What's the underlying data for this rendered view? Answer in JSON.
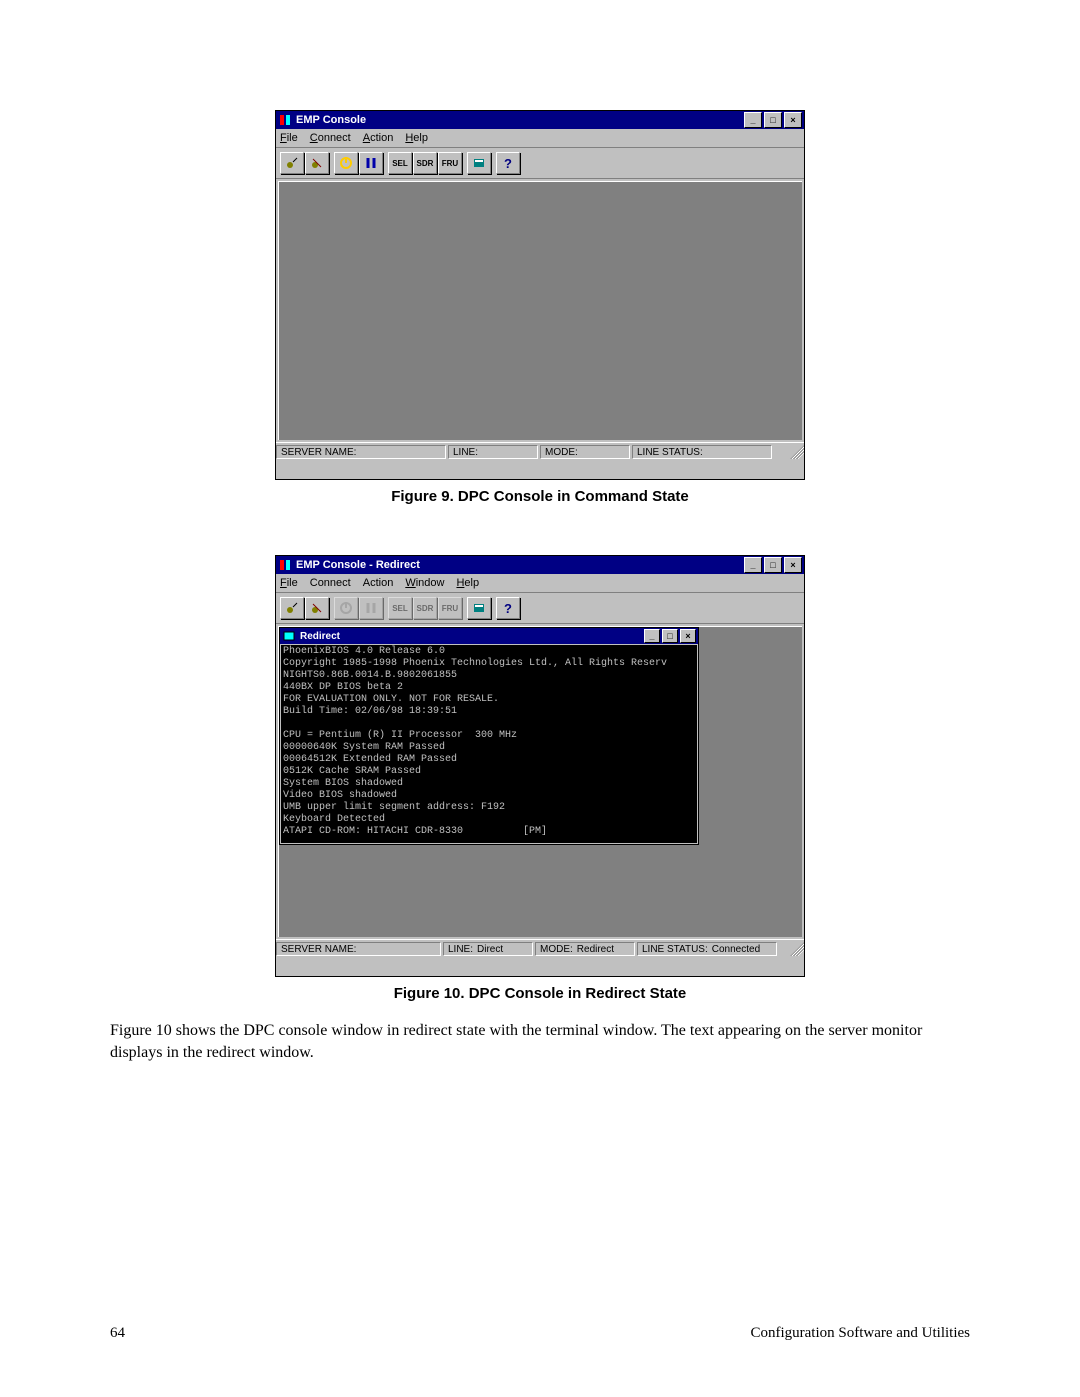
{
  "page": {
    "number": "64",
    "footer_right": "Configuration Software and Utilities"
  },
  "fig1": {
    "title": "EMP Console",
    "menu": {
      "file": "File",
      "connect": "Connect",
      "action": "Action",
      "help": "Help"
    },
    "toolbar": {
      "connect": "connect-icon",
      "disconnect": "disconnect-icon",
      "power": "power-icon",
      "reset": "reset-icon",
      "sel": "SEL",
      "sdr": "SDR",
      "fru": "FRU",
      "phone": "phonebook-icon",
      "help": "?"
    },
    "status": {
      "server_label": "SERVER NAME:",
      "server_value": "",
      "line_label": "LINE:",
      "line_value": "",
      "mode_label": "MODE:",
      "mode_value": "",
      "linestat_label": "LINE STATUS:",
      "linestat_value": ""
    },
    "caption": "Figure 9.  DPC Console in Command State"
  },
  "fig2": {
    "title": "EMP Console - Redirect",
    "menu": {
      "file": "File",
      "connect": "Connect",
      "action": "Action",
      "window": "Window",
      "help": "Help"
    },
    "toolbar": {
      "connect": "connect-icon",
      "disconnect": "disconnect-icon",
      "power": "power-icon",
      "reset": "reset-icon",
      "sel": "SEL",
      "sdr": "SDR",
      "fru": "FRU",
      "phone": "phonebook-icon",
      "help": "?"
    },
    "redirect": {
      "title": "Redirect",
      "lines": [
        "PhoenixBIOS 4.0 Release 6.0",
        "Copyright 1985-1998 Phoenix Technologies Ltd., All Rights Reserv",
        "NIGHTS0.86B.0014.B.9802061855",
        "440BX DP BIOS beta 2",
        "FOR EVALUATION ONLY. NOT FOR RESALE.",
        "Build Time: 02/06/98 18:39:51",
        "",
        "CPU = Pentium (R) II Processor  300 MHz",
        "00000640K System RAM Passed",
        "00064512K Extended RAM Passed",
        "0512K Cache SRAM Passed",
        "System BIOS shadowed",
        "Video BIOS shadowed",
        "UMB upper limit segment address: F192",
        "Keyboard Detected",
        "ATAPI CD-ROM: HITACHI CDR-8330          [PM]"
      ]
    },
    "status": {
      "server_label": "SERVER NAME:",
      "server_value": "",
      "line_label": "LINE:",
      "line_value": "Direct",
      "mode_label": "MODE:",
      "mode_value": "Redirect",
      "linestat_label": "LINE STATUS:",
      "linestat_value": "Connected"
    },
    "caption": "Figure 10.  DPC Console in Redirect State"
  },
  "body_paragraph": "Figure 10 shows the DPC console window in redirect state with the terminal window.  The text appearing on the server monitor displays in the redirect window."
}
